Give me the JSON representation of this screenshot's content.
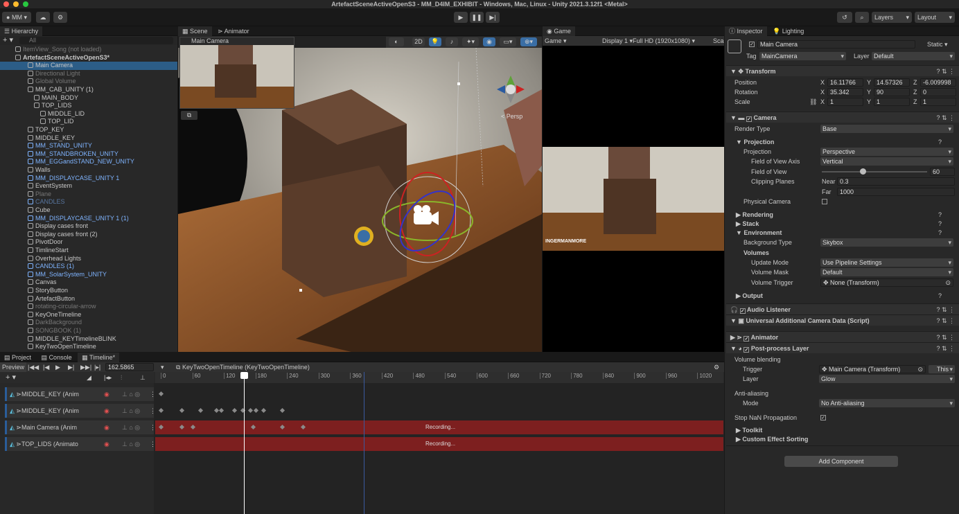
{
  "window": {
    "title": "ArtefactSceneActiveOpenS3 - MM_D4IM_EXHIBIT - Windows, Mac, Linux - Unity 2021.3.12f1 <Metal>"
  },
  "toolbar": {
    "account": "MM",
    "layers": "Layers",
    "layout": "Layout"
  },
  "hierarchy": {
    "tab": "Hierarchy",
    "search_placeholder": "All",
    "rows": [
      {
        "label": "ItemView_Song (not loaded)",
        "indent": 2,
        "style": "dim"
      },
      {
        "label": "ArtefactSceneActiveOpenS3*",
        "indent": 2,
        "style": "bold"
      },
      {
        "label": "Main Camera",
        "indent": 4,
        "style": "sel"
      },
      {
        "label": "Directional Light",
        "indent": 4,
        "style": "dim"
      },
      {
        "label": "Global Volume",
        "indent": 4,
        "style": "dim"
      },
      {
        "label": "MM_CAB_UNITY (1)",
        "indent": 4,
        "style": ""
      },
      {
        "label": "MAIN_BODY",
        "indent": 5,
        "style": ""
      },
      {
        "label": "TOP_LIDS",
        "indent": 5,
        "style": ""
      },
      {
        "label": "MIDDLE_LID",
        "indent": 6,
        "style": ""
      },
      {
        "label": "TOP_LID",
        "indent": 6,
        "style": ""
      },
      {
        "label": "TOP_KEY",
        "indent": 4,
        "style": ""
      },
      {
        "label": "MIDDLE_KEY",
        "indent": 4,
        "style": ""
      },
      {
        "label": "MM_STAND_UNITY",
        "indent": 4,
        "style": "blue"
      },
      {
        "label": "MM_STANDBROKEN_UNITY",
        "indent": 4,
        "style": "blue"
      },
      {
        "label": "MM_EGGandSTAND_NEW_UNITY",
        "indent": 4,
        "style": "blue"
      },
      {
        "label": "Walls",
        "indent": 4,
        "style": ""
      },
      {
        "label": "MM_DISPLAYCASE_UNITY 1",
        "indent": 4,
        "style": "blue"
      },
      {
        "label": "EventSystem",
        "indent": 4,
        "style": ""
      },
      {
        "label": "Plane",
        "indent": 4,
        "style": "dim"
      },
      {
        "label": "CANDLES",
        "indent": 4,
        "style": "dimblue"
      },
      {
        "label": "Cube",
        "indent": 4,
        "style": ""
      },
      {
        "label": "MM_DISPLAYCASE_UNITY 1 (1)",
        "indent": 4,
        "style": "blue"
      },
      {
        "label": "Display cases front",
        "indent": 4,
        "style": ""
      },
      {
        "label": "Display cases front (2)",
        "indent": 4,
        "style": ""
      },
      {
        "label": "PivotDoor",
        "indent": 4,
        "style": ""
      },
      {
        "label": "TimlineStart",
        "indent": 4,
        "style": ""
      },
      {
        "label": "Overhead Lights",
        "indent": 4,
        "style": ""
      },
      {
        "label": "CANDLES (1)",
        "indent": 4,
        "style": "blue"
      },
      {
        "label": "MM_SolarSystem_UNITY",
        "indent": 4,
        "style": "blue"
      },
      {
        "label": "Canvas",
        "indent": 4,
        "style": ""
      },
      {
        "label": "StoryButton",
        "indent": 4,
        "style": ""
      },
      {
        "label": "ArtefactButton",
        "indent": 4,
        "style": ""
      },
      {
        "label": "rotating-circular-arrow",
        "indent": 4,
        "style": "dim"
      },
      {
        "label": "KeyOneTimeline",
        "indent": 4,
        "style": ""
      },
      {
        "label": "DarkBackground",
        "indent": 4,
        "style": "dim"
      },
      {
        "label": "SONGBOOK (1)",
        "indent": 4,
        "style": "dim"
      },
      {
        "label": "MIDDLE_KEYTimelineBLINK",
        "indent": 4,
        "style": ""
      },
      {
        "label": "KeyTwoOpenTimeline",
        "indent": 4,
        "style": ""
      }
    ]
  },
  "scene": {
    "tab_scene": "Scene",
    "tab_animator": "Animator",
    "camera_preview": "Main Camera",
    "mode_2d": "2D",
    "persp": "< Persp"
  },
  "game": {
    "tab": "Game",
    "mode": "Game",
    "display": "Display 1",
    "resolution": "Full HD (1920x1080)",
    "scale": "Sca",
    "watermark": "INGERMANMORE"
  },
  "inspector": {
    "tab": "Inspector",
    "tab2": "Lighting",
    "object_name": "Main Camera",
    "static": "Static",
    "tag_label": "Tag",
    "tag_value": "MainCamera",
    "layer_label": "Layer",
    "layer_value": "Default",
    "transform": {
      "title": "Transform",
      "position": {
        "label": "Position",
        "x": "16.11766",
        "y": "14.57326",
        "z": "-6.009998"
      },
      "rotation": {
        "label": "Rotation",
        "x": "35.342",
        "y": "90",
        "z": "0"
      },
      "scale": {
        "label": "Scale",
        "x": "1",
        "y": "1",
        "z": "1"
      }
    },
    "camera": {
      "title": "Camera",
      "render_type_label": "Render Type",
      "render_type": "Base",
      "projection_header": "Projection",
      "projection_label": "Projection",
      "projection": "Perspective",
      "fov_axis_label": "Field of View Axis",
      "fov_axis": "Vertical",
      "fov_label": "Field of View",
      "fov": "60",
      "fov_fraction": 0.39,
      "clipping_label": "Clipping Planes",
      "near_label": "Near",
      "near": "0.3",
      "far_label": "Far",
      "far": "1000",
      "physical_label": "Physical Camera",
      "rendering": "Rendering",
      "stack": "Stack",
      "environment": "Environment",
      "bg_type_label": "Background Type",
      "bg_type": "Skybox",
      "volumes": "Volumes",
      "update_mode_label": "Update Mode",
      "update_mode": "Use Pipeline Settings",
      "volume_mask_label": "Volume Mask",
      "volume_mask": "Default",
      "volume_trigger_label": "Volume Trigger",
      "volume_trigger": "None (Transform)",
      "output": "Output"
    },
    "audio_listener": "Audio Listener",
    "additional_data": "Universal Additional Camera Data (Script)",
    "animator": "Animator",
    "postprocess": {
      "title": "Post-process Layer",
      "volume_blending": "Volume blending",
      "trigger_label": "Trigger",
      "trigger": "Main Camera (Transform)",
      "this": "This",
      "layer_label": "Layer",
      "layer": "Glow",
      "anti_aliasing": "Anti-aliasing",
      "mode_label": "Mode",
      "mode": "No Anti-aliasing",
      "stop_nan": "Stop NaN Propagation",
      "toolkit": "Toolkit",
      "custom_sorting": "Custom Effect Sorting"
    },
    "add_component": "Add Component"
  },
  "bottom": {
    "tabs": [
      "Project",
      "Console",
      "Timeline*"
    ],
    "preview": "Preview",
    "time": "162.5865",
    "asset": "KeyTwoOpenTimeline (KeyTwoOpenTimeline)",
    "ruler": [
      "0",
      "60",
      "120",
      "180",
      "240",
      "300",
      "360",
      "420",
      "480",
      "540",
      "600",
      "660",
      "720",
      "780",
      "840",
      "900",
      "960",
      "1020"
    ],
    "tracks": [
      {
        "label": "MIDDLE_KEY (Anim",
        "recording": false,
        "keys": [
          0
        ]
      },
      {
        "label": "MIDDLE_KEY (Anim",
        "recording": false,
        "keys": [
          0,
          40,
          75,
          105,
          115,
          140,
          155,
          170,
          180,
          195,
          230
        ]
      },
      {
        "label": "Main Camera (Anim",
        "recording": true,
        "status": "Recording...",
        "keys": [
          0,
          40,
          60,
          175,
          230,
          270
        ]
      },
      {
        "label": "TOP_LIDS (Animato",
        "recording": true,
        "status": "Recording...",
        "keys": []
      }
    ]
  }
}
